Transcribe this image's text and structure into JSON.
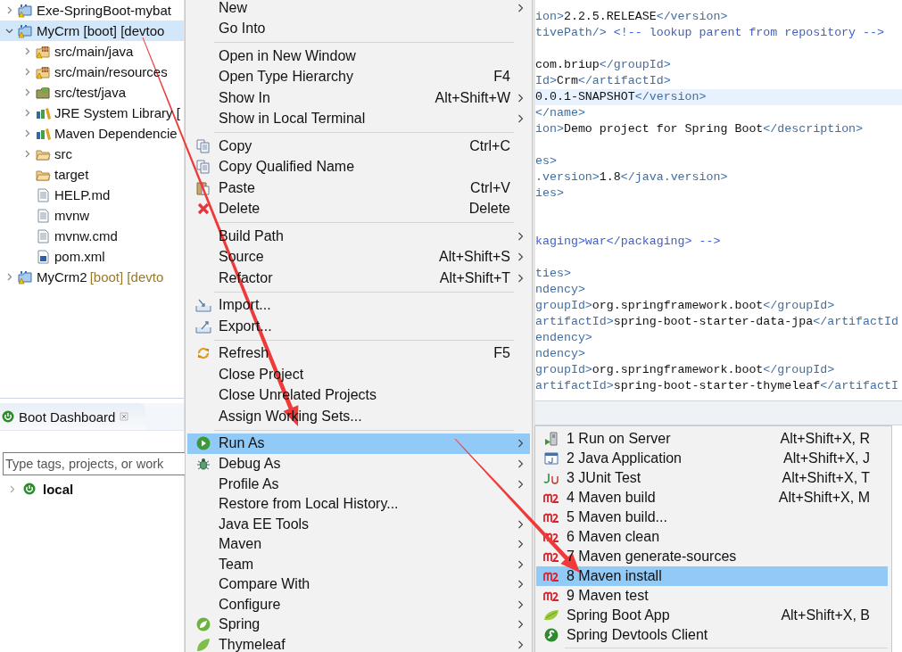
{
  "project_explorer": {
    "items": [
      {
        "kind": "project",
        "label": "Exe-SpringBoot-mybat",
        "expanded": false,
        "selected": false
      },
      {
        "kind": "project",
        "label": "MyCrm [boot] [devtoo",
        "expanded": true,
        "selected": true,
        "children": [
          {
            "kind": "source-folder",
            "label": "src/main/java",
            "expanded": false,
            "selected": false
          },
          {
            "kind": "source-folder",
            "label": "src/main/resources",
            "expanded": false,
            "selected": false
          },
          {
            "kind": "test-folder",
            "label": "src/test/java",
            "expanded": false,
            "selected": false
          },
          {
            "kind": "library",
            "label": "JRE System Library [",
            "expanded": false,
            "selected": false
          },
          {
            "kind": "library",
            "label": "Maven Dependencie",
            "expanded": false,
            "selected": false
          },
          {
            "kind": "folder",
            "label": "src",
            "expanded": false,
            "selected": false
          },
          {
            "kind": "folder",
            "label": "target",
            "selected": false
          },
          {
            "kind": "file",
            "label": "HELP.md",
            "selected": false
          },
          {
            "kind": "file",
            "label": "mvnw",
            "selected": false
          },
          {
            "kind": "file",
            "label": "mvnw.cmd",
            "selected": false
          },
          {
            "kind": "maven-file",
            "label": "pom.xml",
            "selected": false
          }
        ]
      },
      {
        "kind": "project",
        "label": "MyCrm2",
        "decoration": "[boot] [devto",
        "expanded": false,
        "selected": false
      }
    ]
  },
  "boot_dashboard": {
    "title": "Boot Dashboard",
    "search": {
      "placeholder": "Type tags, projects, or work"
    },
    "targets": [
      {
        "label": "local",
        "expanded": false
      }
    ]
  },
  "editor": {
    "lines": [
      {
        "highlighted": false,
        "segments": [
          {
            "kind": "tag",
            "text": "ion>"
          },
          {
            "kind": "text",
            "text": "2.2.5.RELEASE"
          },
          {
            "kind": "tag",
            "text": "</version>"
          }
        ]
      },
      {
        "highlighted": false,
        "segments": [
          {
            "kind": "tag",
            "text": "tivePath/> "
          },
          {
            "kind": "comment",
            "text": "<!-- lookup parent from repository -->"
          }
        ]
      },
      {
        "highlighted": false
      },
      {
        "highlighted": false,
        "segments": [
          {
            "kind": "text",
            "text": "com.briup"
          },
          {
            "kind": "tag",
            "text": "</groupId>"
          }
        ]
      },
      {
        "highlighted": false,
        "segments": [
          {
            "kind": "tag",
            "text": "Id>"
          },
          {
            "kind": "text",
            "text": "Crm"
          },
          {
            "kind": "tag",
            "text": "</artifactId>"
          }
        ]
      },
      {
        "highlighted": true,
        "segments": [
          {
            "kind": "text",
            "text": "0.0.1-SNAPSHOT"
          },
          {
            "kind": "tag",
            "text": "</version>"
          }
        ]
      },
      {
        "highlighted": false,
        "segments": [
          {
            "kind": "tag",
            "text": "</name>"
          }
        ]
      },
      {
        "highlighted": false,
        "segments": [
          {
            "kind": "tag",
            "text": "ion>"
          },
          {
            "kind": "text",
            "text": "Demo project for Spring Boot"
          },
          {
            "kind": "tag",
            "text": "</description>"
          }
        ]
      },
      {
        "highlighted": false
      },
      {
        "highlighted": false,
        "segments": [
          {
            "kind": "tag",
            "text": "es>"
          }
        ]
      },
      {
        "highlighted": false,
        "segments": [
          {
            "kind": "tag",
            "text": ".version>"
          },
          {
            "kind": "text",
            "text": "1.8"
          },
          {
            "kind": "tag",
            "text": "</java.version>"
          }
        ]
      },
      {
        "highlighted": false,
        "segments": [
          {
            "kind": "tag",
            "text": "ies>"
          }
        ]
      },
      {
        "highlighted": false
      },
      {
        "highlighted": false
      },
      {
        "highlighted": false,
        "segments": [
          {
            "kind": "comment",
            "text": "kaging>war</packaging> -->"
          }
        ]
      },
      {
        "highlighted": false
      },
      {
        "highlighted": false,
        "segments": [
          {
            "kind": "tag",
            "text": "ties>"
          }
        ]
      },
      {
        "highlighted": false,
        "segments": [
          {
            "kind": "tag",
            "text": "ndency>"
          }
        ]
      },
      {
        "highlighted": false,
        "segments": [
          {
            "kind": "tag",
            "text": "groupId>"
          },
          {
            "kind": "text",
            "text": "org.springframework.boot"
          },
          {
            "kind": "tag",
            "text": "</groupId>"
          }
        ]
      },
      {
        "highlighted": false,
        "segments": [
          {
            "kind": "tag",
            "text": "artifactId>"
          },
          {
            "kind": "text",
            "text": "spring-boot-starter-data-jpa"
          },
          {
            "kind": "tag",
            "text": "</artifactId"
          }
        ]
      },
      {
        "highlighted": false,
        "segments": [
          {
            "kind": "tag",
            "text": "endency>"
          }
        ]
      },
      {
        "highlighted": false,
        "segments": [
          {
            "kind": "tag",
            "text": "ndency>"
          }
        ]
      },
      {
        "highlighted": false,
        "segments": [
          {
            "kind": "tag",
            "text": "groupId>"
          },
          {
            "kind": "text",
            "text": "org.springframework.boot"
          },
          {
            "kind": "tag",
            "text": "</groupId>"
          }
        ]
      },
      {
        "highlighted": false,
        "segments": [
          {
            "kind": "tag",
            "text": "artifactId>"
          },
          {
            "kind": "text",
            "text": "spring-boot-starter-thymeleaf"
          },
          {
            "kind": "tag",
            "text": "</artifactI"
          }
        ]
      }
    ]
  },
  "context_menu": {
    "items": [
      {
        "kind": "item",
        "label": "New",
        "submenu": true,
        "selected": false
      },
      {
        "kind": "item",
        "label": "Go Into",
        "submenu": false,
        "selected": false
      },
      {
        "kind": "separator"
      },
      {
        "kind": "item",
        "label": "Open in New Window",
        "submenu": false,
        "selected": false
      },
      {
        "kind": "item",
        "label": "Open Type Hierarchy",
        "shortcut": "F4",
        "submenu": false,
        "selected": false
      },
      {
        "kind": "item",
        "label": "Show In",
        "shortcut": "Alt+Shift+W",
        "submenu": true,
        "selected": false
      },
      {
        "kind": "item",
        "label": "Show in Local Terminal",
        "submenu": true,
        "selected": false
      },
      {
        "kind": "separator"
      },
      {
        "kind": "item",
        "label": "Copy",
        "shortcut": "Ctrl+C",
        "submenu": false,
        "selected": false
      },
      {
        "kind": "item",
        "label": "Copy Qualified Name",
        "submenu": false,
        "selected": false
      },
      {
        "kind": "item",
        "label": "Paste",
        "shortcut": "Ctrl+V",
        "submenu": false,
        "selected": false
      },
      {
        "kind": "item",
        "label": "Delete",
        "shortcut": "Delete",
        "submenu": false,
        "selected": false
      },
      {
        "kind": "separator"
      },
      {
        "kind": "item",
        "label": "Build Path",
        "submenu": true,
        "selected": false
      },
      {
        "kind": "item",
        "label": "Source",
        "shortcut": "Alt+Shift+S",
        "submenu": true,
        "selected": false
      },
      {
        "kind": "item",
        "label": "Refactor",
        "shortcut": "Alt+Shift+T",
        "submenu": true,
        "selected": false
      },
      {
        "kind": "separator"
      },
      {
        "kind": "item",
        "label": "Import...",
        "submenu": false,
        "selected": false
      },
      {
        "kind": "item",
        "label": "Export...",
        "submenu": false,
        "selected": false
      },
      {
        "kind": "separator"
      },
      {
        "kind": "item",
        "label": "Refresh",
        "shortcut": "F5",
        "submenu": false,
        "selected": false
      },
      {
        "kind": "item",
        "label": "Close Project",
        "submenu": false,
        "selected": false
      },
      {
        "kind": "item",
        "label": "Close Unrelated Projects",
        "submenu": false,
        "selected": false
      },
      {
        "kind": "item",
        "label": "Assign Working Sets...",
        "submenu": false,
        "selected": false
      },
      {
        "kind": "separator"
      },
      {
        "kind": "item",
        "label": "Run As",
        "submenu": true,
        "selected": true
      },
      {
        "kind": "item",
        "label": "Debug As",
        "submenu": true,
        "selected": false
      },
      {
        "kind": "item",
        "label": "Profile As",
        "submenu": true,
        "selected": false
      },
      {
        "kind": "item",
        "label": "Restore from Local History...",
        "submenu": false,
        "selected": false
      },
      {
        "kind": "item",
        "label": "Java EE Tools",
        "submenu": true,
        "selected": false
      },
      {
        "kind": "item",
        "label": "Maven",
        "submenu": true,
        "selected": false
      },
      {
        "kind": "item",
        "label": "Team",
        "submenu": true,
        "selected": false
      },
      {
        "kind": "item",
        "label": "Compare With",
        "submenu": true,
        "selected": false
      },
      {
        "kind": "item",
        "label": "Configure",
        "submenu": true,
        "selected": false
      },
      {
        "kind": "item",
        "label": "Spring",
        "submenu": true,
        "selected": false
      },
      {
        "kind": "item",
        "label": "Thymeleaf",
        "submenu": true,
        "selected": false
      }
    ]
  },
  "run_as_menu": {
    "items": [
      {
        "kind": "item",
        "label": "1 Run on Server",
        "shortcut": "Alt+Shift+X, R",
        "selected": false
      },
      {
        "kind": "item",
        "label": "2 Java Application",
        "shortcut": "Alt+Shift+X, J",
        "selected": false
      },
      {
        "kind": "item",
        "label": "3 JUnit Test",
        "shortcut": "Alt+Shift+X, T",
        "selected": false
      },
      {
        "kind": "item",
        "label": "4 Maven build",
        "shortcut": "Alt+Shift+X, M",
        "selected": false
      },
      {
        "kind": "item",
        "label": "5 Maven build...",
        "selected": false
      },
      {
        "kind": "item",
        "label": "6 Maven clean",
        "selected": false
      },
      {
        "kind": "item",
        "label": "7 Maven generate-sources",
        "selected": false
      },
      {
        "kind": "item",
        "label": "8 Maven install",
        "selected": true
      },
      {
        "kind": "item",
        "label": "9 Maven test",
        "selected": false
      },
      {
        "kind": "item",
        "label": "Spring Boot App",
        "shortcut": "Alt+Shift+X, B",
        "selected": false
      },
      {
        "kind": "item",
        "label": "Spring Devtools Client",
        "selected": false
      },
      {
        "kind": "separator"
      }
    ]
  }
}
